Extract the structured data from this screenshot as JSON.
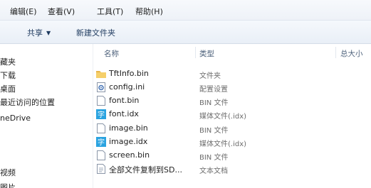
{
  "menubar": {
    "items": [
      "编辑(E)",
      "查看(V)",
      "工具(T)",
      "帮助(H)"
    ]
  },
  "toolbar": {
    "share_label": "共享",
    "new_folder_label": "新建文件夹"
  },
  "navpane": {
    "items": [
      "藏夹",
      "下载",
      "桌面",
      "最近访问的位置",
      "neDrive",
      "视频",
      "图片"
    ]
  },
  "columns": {
    "name": "名称",
    "type": "类型",
    "size": "总大小"
  },
  "files": [
    {
      "name": "TftInfo.bin",
      "type": "文件夹",
      "icon": "folder-icon"
    },
    {
      "name": "config.ini",
      "type": "配置设置",
      "icon": "config-file-icon"
    },
    {
      "name": "font.bin",
      "type": "BIN 文件",
      "icon": "blank-file-icon"
    },
    {
      "name": "font.idx",
      "type": "媒体文件(.idx)",
      "icon": "media-file-icon"
    },
    {
      "name": "image.bin",
      "type": "BIN 文件",
      "icon": "blank-file-icon"
    },
    {
      "name": "image.idx",
      "type": "媒体文件(.idx)",
      "icon": "media-file-icon"
    },
    {
      "name": "screen.bin",
      "type": "BIN 文件",
      "icon": "blank-file-icon"
    },
    {
      "name": "全部文件复制到SD...",
      "type": "文本文档",
      "icon": "text-file-icon"
    }
  ],
  "colors": {
    "folder": "#e8b54a",
    "media": "#2aa3e0",
    "header_text": "#4c607a"
  }
}
